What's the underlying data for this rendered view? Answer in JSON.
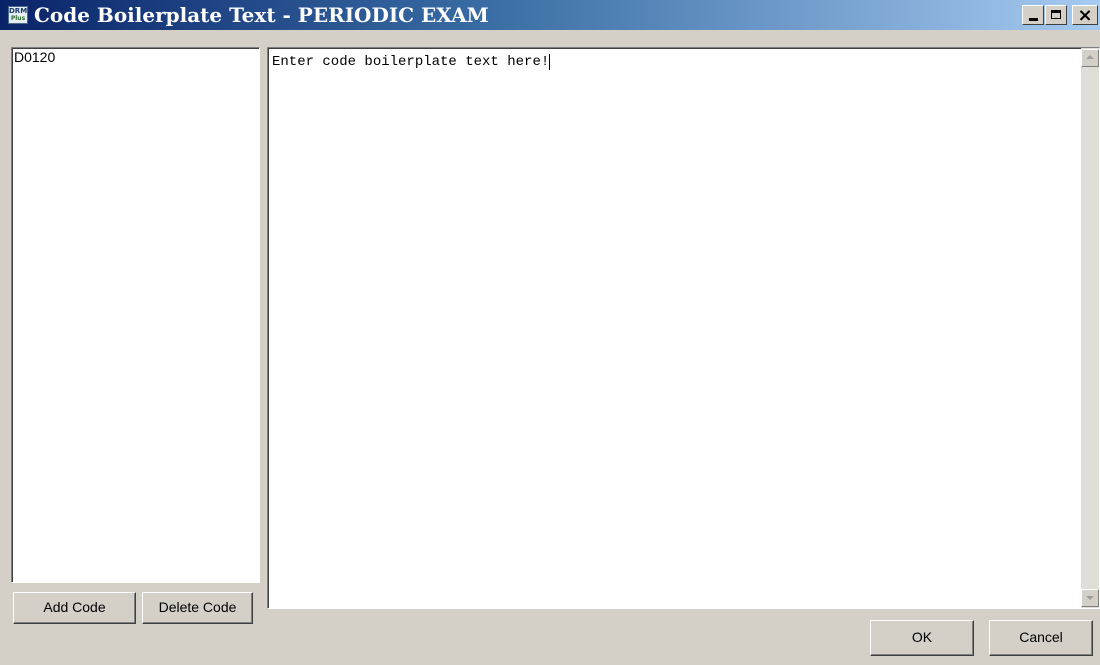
{
  "window": {
    "title": "Code Boilerplate Text - PERIODIC EXAM",
    "icon_line1": "DRM",
    "icon_line2": "Plus",
    "controls": {
      "minimize": "minimize-icon",
      "maximize": "maximize-icon",
      "close": "×"
    }
  },
  "codes": {
    "items": [
      "D0120"
    ],
    "add_label": "Add Code",
    "delete_label": "Delete Code"
  },
  "editor": {
    "text": "Enter code boilerplate text here!"
  },
  "footer": {
    "ok_label": "OK",
    "cancel_label": "Cancel"
  },
  "colors": {
    "title_gradient_start": "#0a246a",
    "title_gradient_end": "#a6caf0",
    "dialog_bg": "#d4d0c8"
  }
}
